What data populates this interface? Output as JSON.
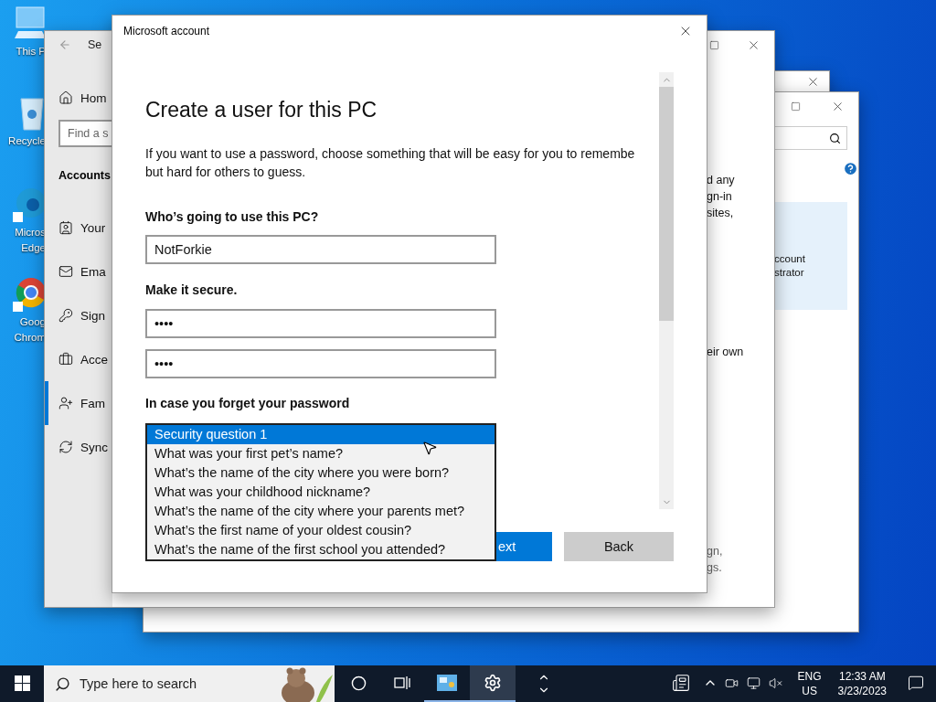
{
  "desktop_icons": [
    {
      "kind": "pc",
      "lines": [
        "This P"
      ]
    },
    {
      "kind": "bin",
      "lines": [
        "Recycle"
      ]
    },
    {
      "kind": "edge",
      "lines": [
        "Micros",
        "Edge"
      ]
    },
    {
      "kind": "chrome",
      "lines": [
        "Goog",
        "Chrom"
      ]
    }
  ],
  "accounts_window": {
    "panel_lines": [
      "ccount",
      "strator"
    ]
  },
  "settings_window": {
    "title": "Se",
    "home": "Hom",
    "search_placeholder": "Find a s",
    "section": "Accounts",
    "nav": [
      {
        "kind": "info",
        "label": "Your",
        "selected": false
      },
      {
        "kind": "mail",
        "label": "Ema",
        "selected": false
      },
      {
        "kind": "key",
        "label": "Sign",
        "selected": false
      },
      {
        "kind": "work",
        "label": "Acce",
        "selected": false
      },
      {
        "kind": "family",
        "label": "Fam",
        "selected": true
      },
      {
        "kind": "sync",
        "label": "Sync",
        "selected": false
      }
    ],
    "right_top_lines": [
      "d any",
      "gn-in",
      "sites,"
    ],
    "right_middle": "eir own",
    "right_bottom_lines": [
      "gn,",
      "gs."
    ]
  },
  "dialog": {
    "title": "Microsoft account",
    "heading": "Create a user for this PC",
    "intro_lines": [
      "If you want to use a password, choose something that will be easy for you to remembe",
      "but hard for others to guess."
    ],
    "name_label": "Who’s going to use this PC?",
    "name_value": "NotForkie",
    "secure_label": "Make it secure.",
    "password": "••••",
    "confirm_password": "••••",
    "recovery_label": "In case you forget your password",
    "questions": [
      {
        "label": "Security question 1",
        "selected": true
      },
      {
        "label": "What was your first pet’s name?",
        "selected": false
      },
      {
        "label": "What’s the name of the city where you were born?",
        "selected": false
      },
      {
        "label": "What was your childhood nickname?",
        "selected": false
      },
      {
        "label": "What’s the name of the city where your parents met?",
        "selected": false
      },
      {
        "label": "What’s the first name of your oldest cousin?",
        "selected": false
      },
      {
        "label": "What’s the name of the first school you attended?",
        "selected": false
      }
    ],
    "buttons": [
      {
        "kind": "primary",
        "label": "ext"
      },
      {
        "kind": "secondary",
        "label": "Back"
      }
    ]
  },
  "taskbar": {
    "search_placeholder": "Type here to search",
    "apps": [
      {
        "kind": "control-panel",
        "active": false
      },
      {
        "kind": "settings",
        "active": true
      }
    ],
    "language": [
      "ENG",
      "US"
    ],
    "time": "12:33 AM",
    "date": "3/23/2023"
  }
}
